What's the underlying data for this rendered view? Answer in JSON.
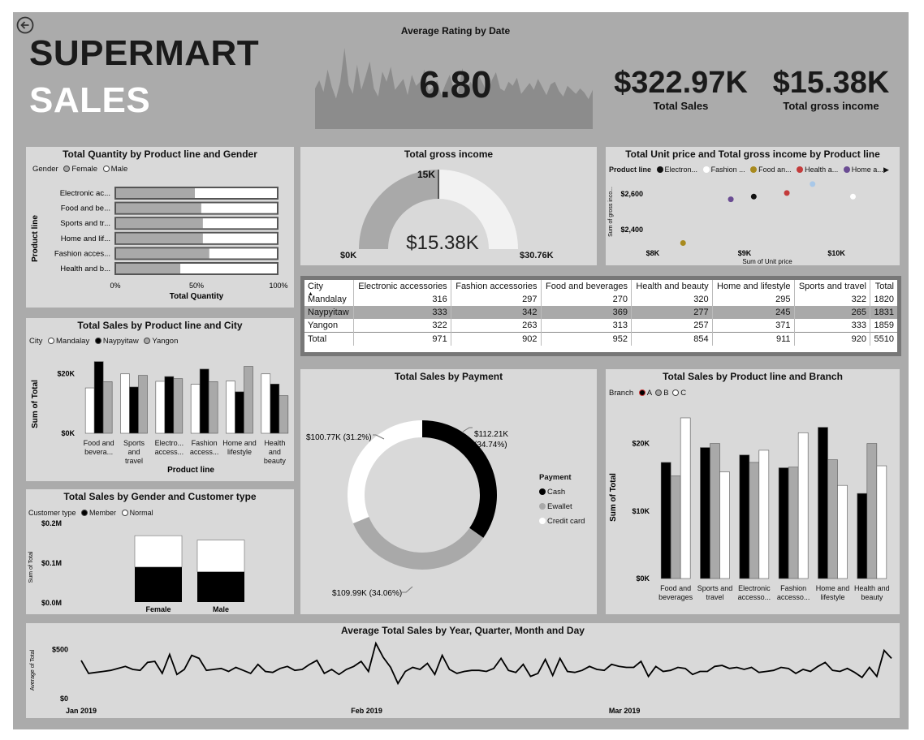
{
  "header": {
    "title_line1": "SUPERMART",
    "title_line2": "SALES",
    "back_icon": "back-arrow-icon"
  },
  "rating": {
    "title": "Average Rating by Date",
    "value": "6.80"
  },
  "kpis": [
    {
      "value": "$322.97K",
      "label": "Total Sales"
    },
    {
      "value": "$15.38K",
      "label": "Total gross income"
    }
  ],
  "qty_gender": {
    "title": "Total Quantity by Product line and Gender",
    "legend_title": "Gender",
    "legend": [
      "Female",
      "Male"
    ],
    "y_axis_label": "Product line",
    "x_axis_label": "Total Quantity",
    "x_ticks": [
      "0%",
      "50%",
      "100%"
    ],
    "chart_data": {
      "type": "bar",
      "categories": [
        "Electronic ac...",
        "Food and be...",
        "Sports and tr...",
        "Home and lif...",
        "Fashion acces...",
        "Health and b..."
      ],
      "series": [
        {
          "name": "Female",
          "values": [
            0.49,
            0.53,
            0.54,
            0.54,
            0.58,
            0.4
          ]
        },
        {
          "name": "Male",
          "values": [
            0.51,
            0.47,
            0.46,
            0.46,
            0.42,
            0.6
          ]
        }
      ],
      "stacked": "100%"
    }
  },
  "gauge": {
    "title": "Total gross income",
    "value": "$15.38K",
    "min": "$0K",
    "max": "$30.76K",
    "target": "15K",
    "chart_data": {
      "type": "gauge",
      "value": 15.38,
      "min": 0,
      "max": 30.76,
      "target": 15.38
    }
  },
  "scatter": {
    "title": "Total Unit price and Total gross income by Product line",
    "legend_title": "Product line",
    "legend": [
      {
        "name": "Electron...",
        "color": "#111111"
      },
      {
        "name": "Fashion ...",
        "color": "#ffffff"
      },
      {
        "name": "Food an...",
        "color": "#a88a1e"
      },
      {
        "name": "Health a...",
        "color": "#c33b3b"
      },
      {
        "name": "Home a...",
        "color": "#6a4c93"
      }
    ],
    "x_label": "Sum of Unit price",
    "y_label": "Sum of gross inco...",
    "x_ticks": [
      "$8K",
      "$9K",
      "$10K"
    ],
    "y_ticks": [
      "$2,600",
      "$2,400"
    ],
    "chart_data": {
      "type": "scatter",
      "xlim": [
        7700,
        10600
      ],
      "ylim": [
        2300,
        2700
      ],
      "points": [
        {
          "x": 8330,
          "y": 2325,
          "color": "#a88a1e"
        },
        {
          "x": 8850,
          "y": 2570,
          "color": "#6a4c93"
        },
        {
          "x": 9100,
          "y": 2585,
          "color": "#111111"
        },
        {
          "x": 9460,
          "y": 2605,
          "color": "#c33b3b"
        },
        {
          "x": 9740,
          "y": 2655,
          "color": "#a9c8e8"
        },
        {
          "x": 10180,
          "y": 2585,
          "color": "#ffffff"
        }
      ]
    }
  },
  "matrix": {
    "headers": [
      "City",
      "Electronic accessories",
      "Fashion accessories",
      "Food and beverages",
      "Health and beauty",
      "Home and lifestyle",
      "Sports and travel",
      "Total"
    ],
    "rows": [
      [
        "Mandalay",
        "316",
        "297",
        "270",
        "320",
        "295",
        "322",
        "1820"
      ],
      [
        "Naypyitaw",
        "333",
        "342",
        "369",
        "277",
        "245",
        "265",
        "1831"
      ],
      [
        "Yangon",
        "322",
        "263",
        "313",
        "257",
        "371",
        "333",
        "1859"
      ],
      [
        "Total",
        "971",
        "902",
        "952",
        "854",
        "911",
        "920",
        "5510"
      ]
    ]
  },
  "sales_city": {
    "title": "Total Sales by Product line and City",
    "legend_title": "City",
    "legend": [
      "Mandalay",
      "Naypyitaw",
      "Yangon"
    ],
    "y_axis_label": "Sum of Total",
    "x_axis_label": "Product line",
    "y_ticks": [
      "$20K",
      "$0K"
    ],
    "chart_data": {
      "type": "bar",
      "ylim": [
        0,
        25000
      ],
      "categories": [
        "Food and bevera...",
        "Sports and travel",
        "Electro... access...",
        "Fashion access...",
        "Home and lifestyle",
        "Health and beauty"
      ],
      "series": [
        {
          "name": "Mandalay",
          "values": [
            15200,
            19900,
            17400,
            16400,
            17500,
            19900
          ]
        },
        {
          "name": "Naypyitaw",
          "values": [
            24000,
            15500,
            19000,
            21500,
            13900,
            16500
          ]
        },
        {
          "name": "Yangon",
          "values": [
            17300,
            19400,
            18300,
            17300,
            22400,
            12600
          ]
        }
      ]
    }
  },
  "gender_cust": {
    "title": "Total Sales by Gender and Customer type",
    "legend_title": "Customer type",
    "legend": [
      "Member",
      "Normal"
    ],
    "y_axis_label": "Sum of Total",
    "x_axis_label": "Gender",
    "y_ticks": [
      "$0.2M",
      "$0.1M",
      "$0.0M"
    ],
    "chart_data": {
      "type": "bar",
      "stacked": true,
      "ylim": [
        0,
        0.2
      ],
      "categories": [
        "Female",
        "Male"
      ],
      "series": [
        {
          "name": "Member",
          "values": [
            0.088,
            0.076
          ]
        },
        {
          "name": "Normal",
          "values": [
            0.079,
            0.08
          ]
        }
      ]
    }
  },
  "payment": {
    "title": "Total Sales by Payment",
    "legend_title": "Payment",
    "legend": [
      "Cash",
      "Ewallet",
      "Credit card"
    ],
    "labels": [
      "$112.21K",
      "(34.74%)",
      "$109.99K (34.06%)",
      "$100.77K (31.2%)"
    ],
    "chart_data": {
      "type": "pie",
      "donut": true,
      "slices": [
        {
          "name": "Cash",
          "value": 112.21,
          "pct": 34.74,
          "color": "#000000"
        },
        {
          "name": "Ewallet",
          "value": 109.99,
          "pct": 34.06,
          "color": "#a9a9a9"
        },
        {
          "name": "Credit card",
          "value": 100.77,
          "pct": 31.2,
          "color": "#ffffff"
        }
      ]
    }
  },
  "branch": {
    "title": "Total Sales by Product line and Branch",
    "legend_title": "Branch",
    "legend": [
      "A",
      "B",
      "C"
    ],
    "y_axis_label": "Sum of Total",
    "x_axis_label": "Product line",
    "y_ticks": [
      "$20K",
      "$10K",
      "$0K"
    ],
    "chart_data": {
      "type": "bar",
      "ylim": [
        0,
        25000
      ],
      "categories": [
        "Food and beverages",
        "Sports and travel",
        "Electronic accesso...",
        "Fashion accesso...",
        "Home and lifestyle",
        "Health and beauty"
      ],
      "series": [
        {
          "name": "A",
          "values": [
            17200,
            19400,
            18300,
            16400,
            22400,
            12600
          ]
        },
        {
          "name": "B",
          "values": [
            15200,
            20000,
            17200,
            16500,
            17600,
            20000
          ]
        },
        {
          "name": "C",
          "values": [
            23800,
            15800,
            19000,
            21600,
            13800,
            16700
          ]
        }
      ]
    }
  },
  "timeline": {
    "title": "Average Total Sales by Year, Quarter, Month and Day",
    "y_axis_label": "Average of Total",
    "y_ticks": [
      "$500",
      "$0"
    ],
    "x_ticks": [
      "Jan 2019",
      "Feb 2019",
      "Mar 2019"
    ],
    "chart_data": {
      "type": "line",
      "ylim": [
        0,
        600
      ],
      "x_start": "2019-01-01",
      "x_end": "2019-03-30",
      "values": [
        390,
        260,
        270,
        280,
        290,
        310,
        330,
        300,
        290,
        370,
        380,
        260,
        450,
        250,
        300,
        440,
        410,
        290,
        300,
        310,
        280,
        320,
        290,
        260,
        350,
        280,
        270,
        310,
        330,
        290,
        300,
        350,
        390,
        260,
        300,
        250,
        300,
        330,
        380,
        280,
        560,
        420,
        320,
        160,
        280,
        320,
        300,
        360,
        250,
        440,
        300,
        260,
        280,
        290,
        290,
        280,
        310,
        410,
        290,
        270,
        350,
        230,
        260,
        400,
        240,
        410,
        280,
        270,
        290,
        330,
        300,
        290,
        350,
        330,
        320,
        320,
        380,
        230,
        330,
        280,
        290,
        320,
        310,
        250,
        280,
        280,
        330,
        340,
        310,
        320,
        300,
        320,
        270,
        280,
        290,
        320,
        310,
        260,
        300,
        280,
        330,
        370,
        290,
        280,
        310,
        270,
        220,
        320,
        230,
        490,
        410
      ]
    }
  },
  "rating_series": [
    60,
    72,
    55,
    88,
    62,
    45,
    70,
    120,
    65,
    52,
    95,
    58,
    78,
    100,
    60,
    48,
    85,
    70,
    92,
    58,
    66,
    74,
    50,
    80,
    64,
    70,
    88,
    56,
    62,
    72,
    50,
    66,
    80,
    60,
    54,
    90,
    62,
    70,
    58,
    78,
    66,
    50,
    72,
    84,
    60,
    56,
    70,
    64,
    76,
    52,
    60,
    68,
    58,
    74,
    62,
    50,
    66,
    70,
    56,
    48,
    64,
    58,
    52,
    60,
    54,
    44,
    58
  ]
}
